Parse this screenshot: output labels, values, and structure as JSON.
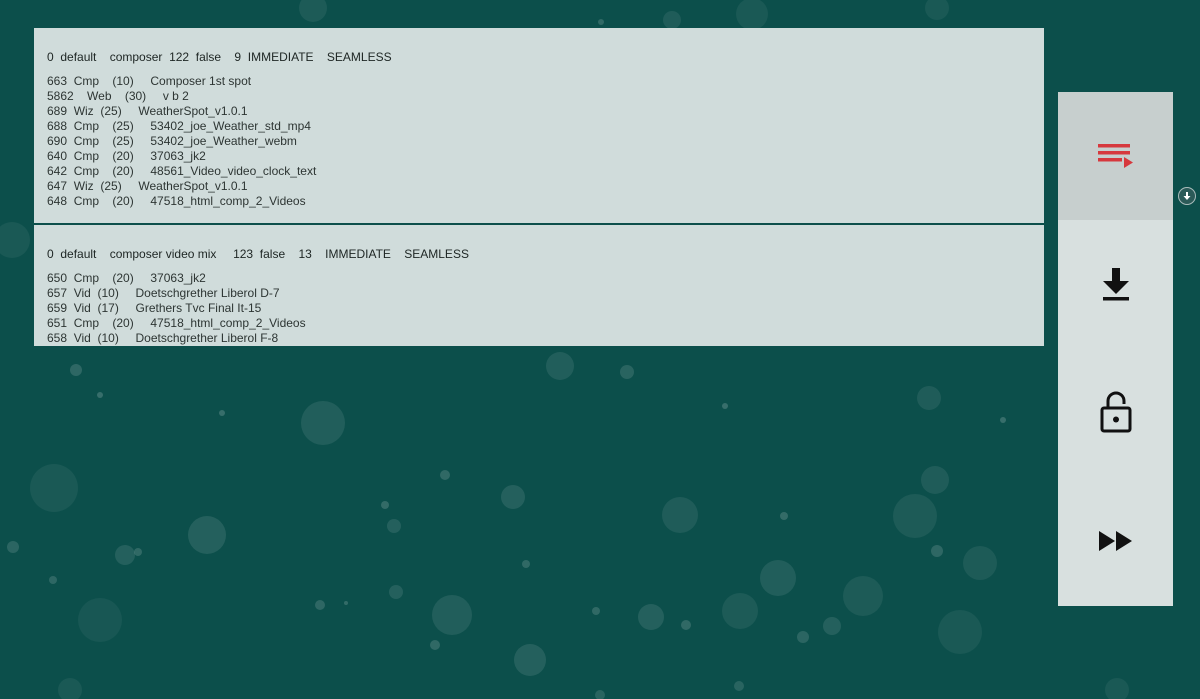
{
  "playlists": [
    {
      "header": "0  default    composer  122  false    9  IMMEDIATE    SEAMLESS",
      "items": [
        "663  Cmp    (10)     Composer 1st spot",
        "5862    Web    (30)     v b 2",
        "689  Wiz  (25)     WeatherSpot_v1.0.1",
        "688  Cmp    (25)     53402_joe_Weather_std_mp4",
        "690  Cmp    (25)     53402_joe_Weather_webm",
        "640  Cmp    (20)     37063_jk2",
        "642  Cmp    (20)     48561_Video_video_clock_text",
        "647  Wiz  (25)     WeatherSpot_v1.0.1",
        "648  Cmp    (20)     47518_html_comp_2_Videos"
      ]
    },
    {
      "header": "0  default    composer video mix     123  false    13    IMMEDIATE    SEAMLESS",
      "items": [
        "650  Cmp    (20)     37063_jk2",
        "657  Vid  (10)     Doetschgrether Liberol D-7",
        "659  Vid  (17)     Grethers Tvc Final It-15",
        "651  Cmp    (20)     47518_html_comp_2_Videos",
        "658  Vid  (10)     Doetschgrether Liberol F-8"
      ]
    }
  ],
  "controls": [
    {
      "icon": "playlist-play-icon",
      "active": true
    },
    {
      "icon": "download-icon",
      "active": false
    },
    {
      "icon": "lock-open-icon",
      "active": false
    },
    {
      "icon": "fast-forward-icon",
      "active": false
    }
  ],
  "scroll_indicator_icon": "arrow-down-circle-icon",
  "colors": {
    "background": "#0c4f4b",
    "panel": "#dbe4e3",
    "controls": "#d8e0df",
    "accent": "#d6383d"
  }
}
